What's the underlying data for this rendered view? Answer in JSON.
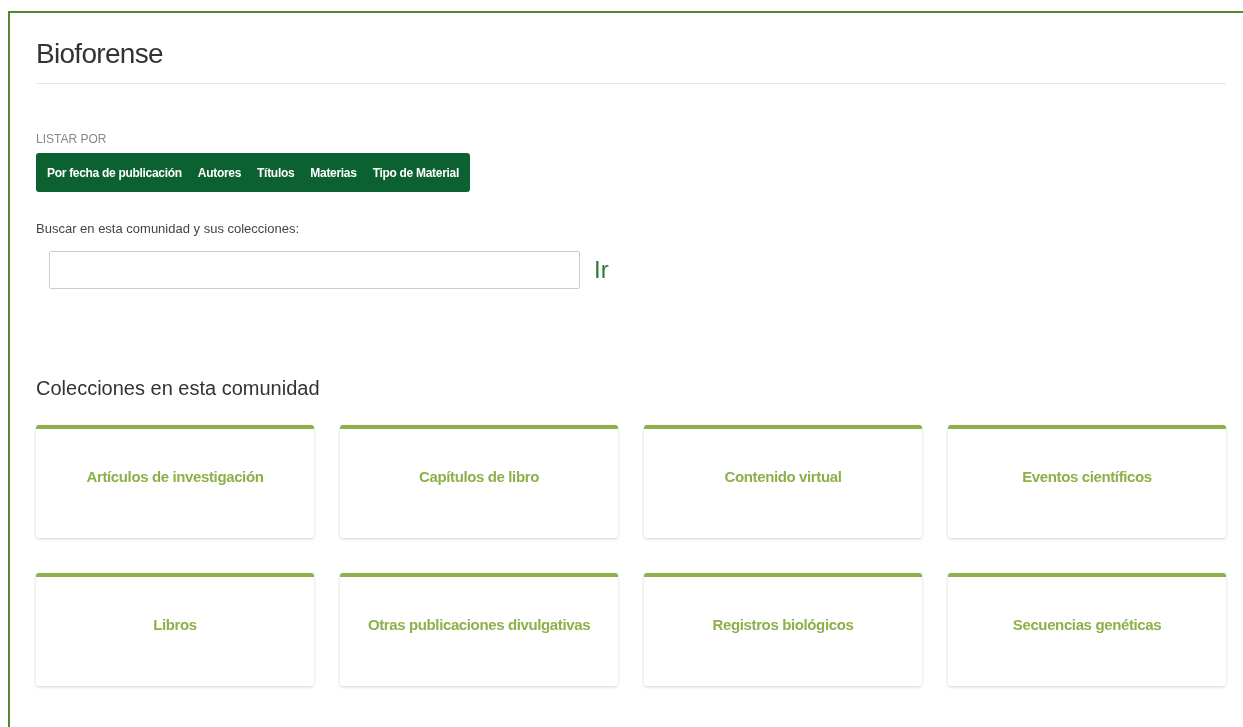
{
  "title": "Bioforense",
  "browse": {
    "label": "LISTAR POR",
    "items": [
      "Por fecha de publicación",
      "Autores",
      "Títulos",
      "Materias",
      "Tipo de Material"
    ]
  },
  "search": {
    "label": "Buscar en esta comunidad y sus colecciones:",
    "button": "Ir"
  },
  "collections": {
    "heading": "Colecciones en esta comunidad",
    "items": [
      {
        "name": "Artículos de investigación"
      },
      {
        "name": "Capítulos de libro"
      },
      {
        "name": "Contenido virtual"
      },
      {
        "name": "Eventos científicos"
      },
      {
        "name": "Libros"
      },
      {
        "name": "Otras publicaciones divulgativas"
      },
      {
        "name": "Registros biológicos"
      },
      {
        "name": "Secuencias genéticas"
      }
    ]
  }
}
